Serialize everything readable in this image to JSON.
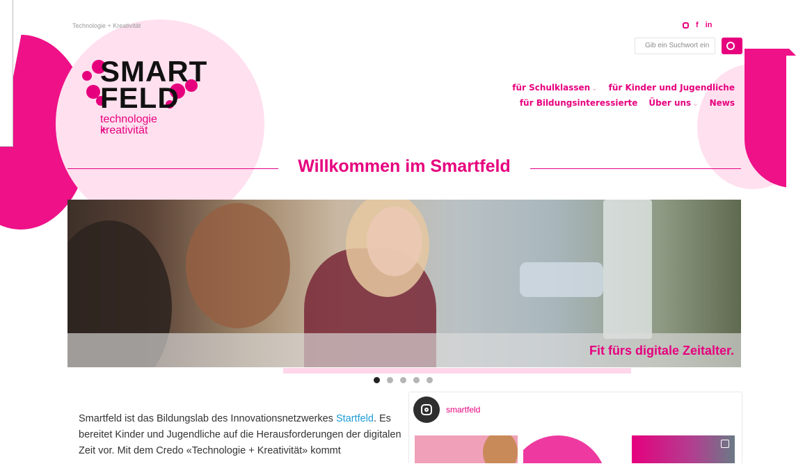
{
  "header": {
    "tagline": "Technologie + Kreativität",
    "social": [
      {
        "icon": "instagram-icon",
        "glyph": ""
      },
      {
        "icon": "facebook-icon",
        "glyph": "f"
      },
      {
        "icon": "linkedin-icon",
        "glyph": "in"
      }
    ],
    "search": {
      "placeholder": "Gib ein Suchwort ein"
    }
  },
  "logo": {
    "line1": "SMART",
    "line2": "FELD",
    "sub1": "technologie +",
    "sub2": "kreativität"
  },
  "nav": {
    "row1": [
      "für Schulklassen",
      "für Kinder und Jugendliche"
    ],
    "row2": [
      "für Bildungsinteressierte",
      "Über uns",
      "News"
    ]
  },
  "page": {
    "title": "Willkommen im Smartfeld"
  },
  "hero": {
    "caption": "Fit fürs digitale Zeitalter.",
    "slides_count": 5,
    "active_slide": 1
  },
  "intro": {
    "part1": "Smartfeld ist das Bildungslab des Innovationsnetzwerkes ",
    "link": "Startfeld",
    "part2": ". Es bereitet Kinder und Jugendliche auf die Herausforderungen der digitalen Zeit vor. Mit dem Credo «Technologie + Kreativität» kommt"
  },
  "instagram": {
    "handle": "smartfeld"
  },
  "colors": {
    "brand_magenta": "#e6007e",
    "light_pink": "#ffe0ef",
    "link_blue": "#1e9bd6"
  }
}
